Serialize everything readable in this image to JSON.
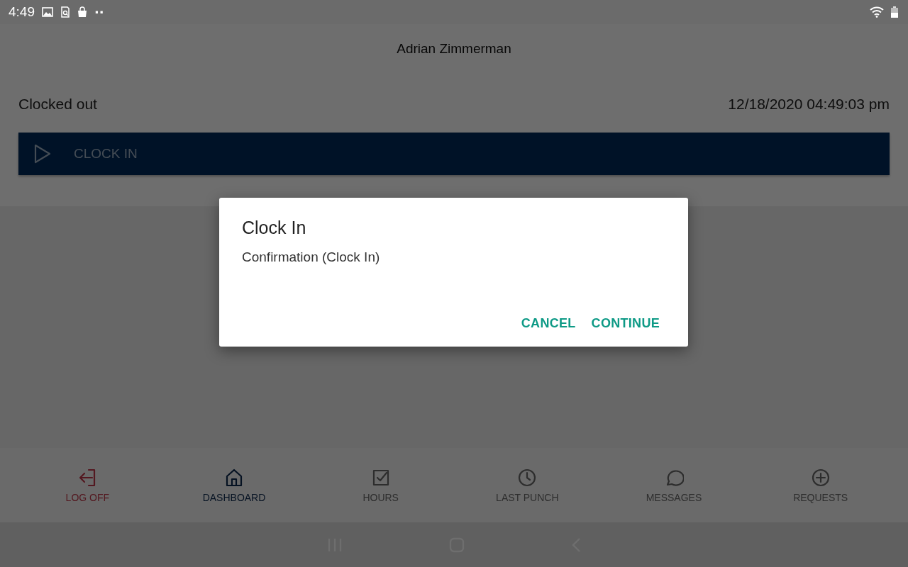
{
  "status_bar": {
    "time": "4:49",
    "more": "··"
  },
  "header": {
    "user_name": "Adrian Zimmerman"
  },
  "status": {
    "state": "Clocked out",
    "datetime": "12/18/2020 04:49:03 pm"
  },
  "clock_button": {
    "label": "CLOCK IN"
  },
  "dialog": {
    "title": "Clock In",
    "message": "Confirmation (Clock In)",
    "buttons": [
      "CANCEL",
      "CONTINUE"
    ]
  },
  "nav": [
    {
      "label": "LOG OFF",
      "kind": "exit",
      "selected": false
    },
    {
      "label": "DASHBOARD",
      "kind": "tab",
      "selected": true
    },
    {
      "label": "HOURS",
      "kind": "tab",
      "selected": false
    },
    {
      "label": "LAST PUNCH",
      "kind": "tab",
      "selected": false
    },
    {
      "label": "MESSAGES",
      "kind": "tab",
      "selected": false
    },
    {
      "label": "REQUESTS",
      "kind": "tab",
      "selected": false
    }
  ]
}
